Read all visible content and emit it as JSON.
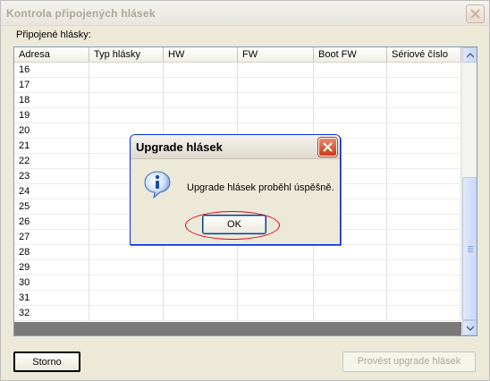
{
  "window": {
    "title": "Kontrola připojených hlásek"
  },
  "group_label": "Připojené hlásky:",
  "table": {
    "columns": [
      "Adresa",
      "Typ hlásky",
      "HW",
      "FW",
      "Boot FW",
      "Sériové číslo"
    ],
    "rows": [
      "16",
      "17",
      "18",
      "19",
      "20",
      "21",
      "22",
      "23",
      "24",
      "25",
      "26",
      "27",
      "28",
      "29",
      "30",
      "31",
      "32"
    ]
  },
  "buttons": {
    "storno": "Storno",
    "upgrade": "Provést upgrade hlásek"
  },
  "dialog": {
    "title": "Upgrade hlásek",
    "message": "Upgrade hlásek proběhl úspěšně.",
    "ok": "OK",
    "icon": "info-icon"
  },
  "colors": {
    "highlight_ring": "#e3001b",
    "dialog_border": "#0831d9"
  }
}
